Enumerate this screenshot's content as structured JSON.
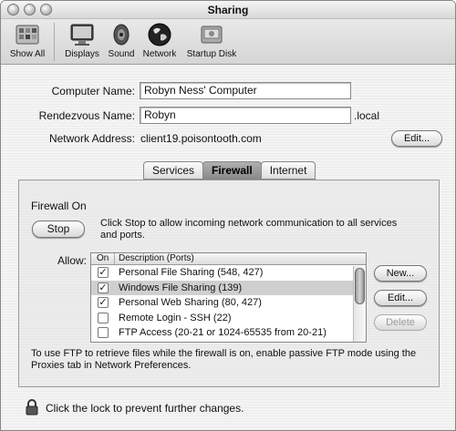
{
  "window": {
    "title": "Sharing"
  },
  "toolbar": {
    "items": [
      {
        "label": "Show All",
        "icon": "show-all-icon"
      },
      {
        "label": "Displays",
        "icon": "displays-icon"
      },
      {
        "label": "Sound",
        "icon": "sound-icon"
      },
      {
        "label": "Network",
        "icon": "network-globe-icon"
      },
      {
        "label": "Startup Disk",
        "icon": "startup-disk-icon"
      }
    ]
  },
  "identity": {
    "computer_name_label": "Computer Name:",
    "computer_name_value": "Robyn Ness' Computer",
    "rendezvous_label": "Rendezvous Name:",
    "rendezvous_value": "Robyn",
    "rendezvous_suffix": ".local",
    "network_address_label": "Network Address:",
    "network_address_value": "client19.poisontooth.com",
    "edit_button": "Edit..."
  },
  "tabs": [
    {
      "label": "Services",
      "active": false
    },
    {
      "label": "Firewall",
      "active": true
    },
    {
      "label": "Internet",
      "active": false
    }
  ],
  "firewall": {
    "status": "Firewall On",
    "stop_button": "Stop",
    "stop_help": "Click Stop to allow incoming network communication to all services and ports.",
    "allow_label": "Allow:",
    "columns": {
      "on": "On",
      "description": "Description (Ports)"
    },
    "rows": [
      {
        "checked": true,
        "description": "Personal File Sharing (548, 427)",
        "selected": false
      },
      {
        "checked": true,
        "description": "Windows File Sharing (139)",
        "selected": true
      },
      {
        "checked": true,
        "description": "Personal Web Sharing (80, 427)",
        "selected": false
      },
      {
        "checked": false,
        "description": "Remote Login - SSH (22)",
        "selected": false
      },
      {
        "checked": false,
        "description": "FTP Access (20-21 or 1024-65535 from 20-21)",
        "selected": false
      }
    ],
    "new_button": "New...",
    "edit_button": "Edit...",
    "delete_button": "Delete",
    "ftp_note": "To use FTP to retrieve files while the firewall is on, enable passive FTP mode using the Proxies tab in Network Preferences."
  },
  "lock": {
    "text": "Click the lock to prevent further changes.",
    "icon": "lock-icon"
  }
}
